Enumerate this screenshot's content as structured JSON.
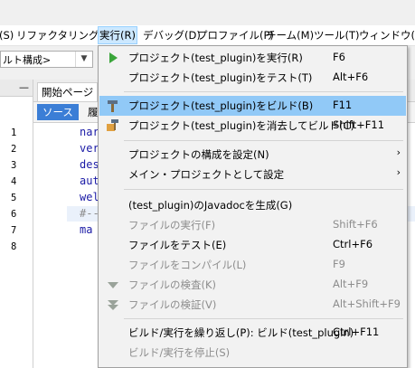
{
  "menubar": {
    "items": [
      "(S)",
      "リファクタリング(A)",
      "実行(R)",
      "デバッグ(D)",
      "プロファイル(P)",
      "チーム(M)",
      "ツール(T)",
      "ウィンドウ(W)"
    ]
  },
  "toolbar": {
    "config_value": "ルト構成>"
  },
  "editor": {
    "tab_label": "開始ページ",
    "subtabs": [
      "ソース",
      "履"
    ],
    "line_numbers": [
      "1",
      "2",
      "3",
      "4",
      "5",
      "6",
      "7",
      "8"
    ],
    "lines": [
      "nar",
      "ver",
      "des",
      "aut",
      "wel",
      "#--",
      "ma",
      ""
    ]
  },
  "left_panel": {
    "minimize": "—"
  },
  "run_menu": {
    "items": [
      {
        "label": "プロジェクト(test_plugin)を実行(R)",
        "shortcut": "F6"
      },
      {
        "label": "プロジェクト(test_plugin)をテスト(T)",
        "shortcut": "Alt+F6"
      },
      {
        "label": "プロジェクト(test_plugin)をビルド(B)",
        "shortcut": "F11"
      },
      {
        "label": "プロジェクト(test_plugin)を消去してビルド(C)",
        "shortcut": "Shift+F11"
      },
      {
        "label": "プロジェクトの構成を設定(N)",
        "shortcut": ""
      },
      {
        "label": "メイン・プロジェクトとして設定",
        "shortcut": ""
      },
      {
        "label": "(test_plugin)のJavadocを生成(G)",
        "shortcut": ""
      },
      {
        "label": "ファイルの実行(F)",
        "shortcut": "Shift+F6"
      },
      {
        "label": "ファイルをテスト(E)",
        "shortcut": "Ctrl+F6"
      },
      {
        "label": "ファイルをコンパイル(L)",
        "shortcut": "F9"
      },
      {
        "label": "ファイルの検査(K)",
        "shortcut": "Alt+F9"
      },
      {
        "label": "ファイルの検証(V)",
        "shortcut": "Alt+Shift+F9"
      },
      {
        "label": "ビルド/実行を繰り返し(P): ビルド(test_plugin)",
        "shortcut": "Ctrl+F11"
      },
      {
        "label": "ビルド/実行を停止(S)",
        "shortcut": ""
      }
    ],
    "submenu_arrow": "›"
  },
  "colors": {
    "highlight": "#91c9f7",
    "active_menu": "#cce8ff",
    "code": "#1a1aa6"
  }
}
